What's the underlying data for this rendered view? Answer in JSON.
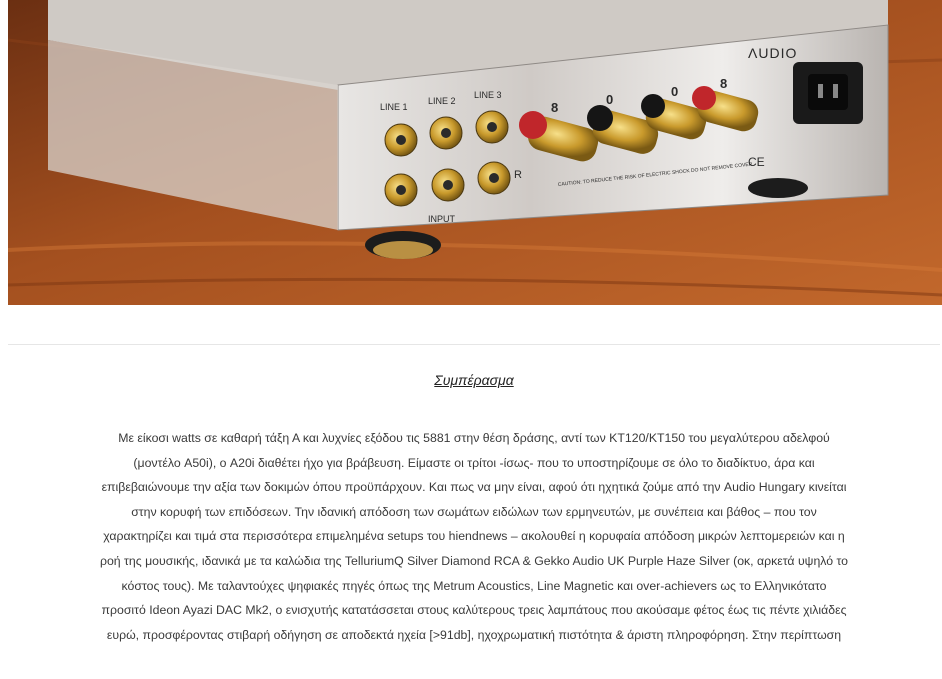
{
  "photo": {
    "description_label": "amplifier-rear-panel-photo",
    "brand_mark": "ΛUDIO",
    "labels": {
      "line1": "LINE 1",
      "line2": "LINE 2",
      "line3": "LINE 3",
      "input": "INPUT",
      "r": "R",
      "ohm8a": "8",
      "ohm0a": "0",
      "ohm0b": "0",
      "ohm8b": "8",
      "ce": "CE",
      "caution": "CAUTION: TO REDUCE THE RISK OF ELECTRIC SHOCK DO NOT REMOVE COVER"
    }
  },
  "article": {
    "heading": "Συμπέρασμα",
    "lines": [
      "Με είκοσι watts σε καθαρή τάξη Α και λυχνίες εξόδου τις 5881 στην θέση δράσης, αντί των KT120/KT150 του μεγαλύτερου αδελφού",
      "(μοντέλο A50i), ο A20i διαθέτει ήχο για βράβευση. Είμαστε οι τρίτοι -ίσως- που το υποστηρίζουμε σε όλο το διαδίκτυο, άρα και",
      "επιβεβαιώνουμε την αξία των δοκιμών όπου προϋπάρχουν. Και πως να μην είναι, αφού ότι ηχητικά ζούμε από την Audio Hungary κινείται",
      "στην κορυφή των επιδόσεων.  Την ιδανική απόδοση των σωμάτων ειδώλων των ερμηνευτών, με συνέπεια και βάθος – που τον",
      "χαρακτηρίζει και τιμά στα περισσότερα επιμελημένα setups του hiendnews – ακολουθεί η κορυφαία απόδοση μικρών λεπτομερειών και η",
      "ροή της μουσικής, ιδανικά με τα καλώδια της TelluriumQ Silver Diamond RCA & Gekko Audio UK Purple Haze Silver (οκ, αρκετά υψηλό το",
      "κόστος τους). Με ταλαντούχες ψηφιακές πηγές όπως της Metrum Acoustics, Line Magnetic και over-achievers ως το Ελληνικότατο",
      "προσιτό Ideon Ayazi DAC Mk2, ο ενισχυτής κατατάσσεται στους καλύτερους τρεις λαμπάτους που ακούσαμε φέτος έως τις πέντε χιλιάδες",
      "ευρώ, προσφέροντας στιβαρή οδήγηση σε αποδεκτά ηχεία [>91db], ηχοχρωματική πιστότητα & άριστη πληροφόρηση. Στην περίπτωση"
    ]
  }
}
